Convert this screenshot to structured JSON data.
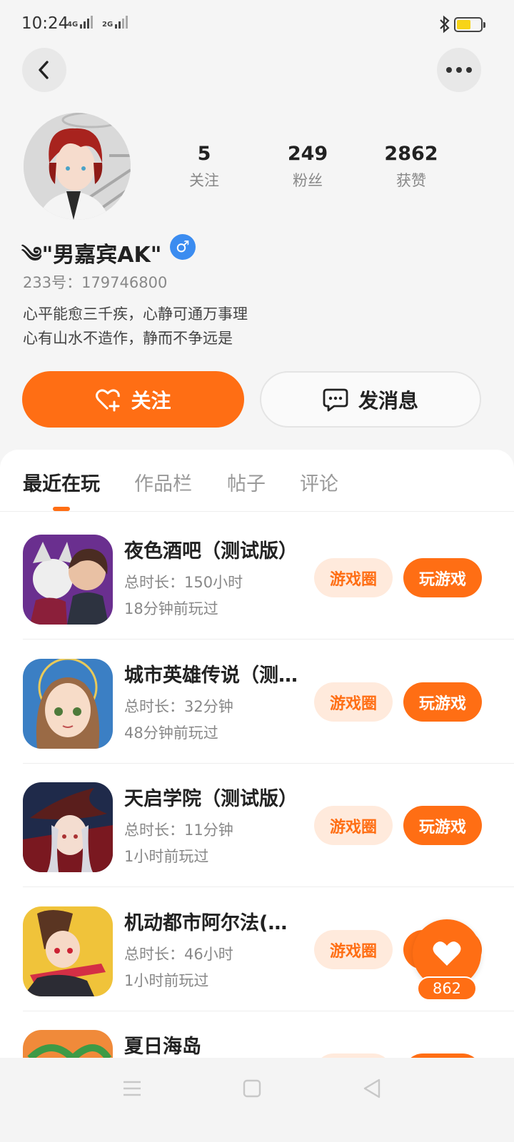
{
  "status_bar": {
    "time": "10:24",
    "net1": "4G",
    "net2": "2G",
    "icons": [
      "signal-icon",
      "bluetooth-icon",
      "battery-icon"
    ],
    "battery_color": "#f7d417"
  },
  "header": {
    "back_icon": "back-chevron-icon",
    "more_icon": "more-dots-icon"
  },
  "profile": {
    "username": "༄\"男嘉宾AK\"",
    "gender_symbol": "♂",
    "uid": "233号：179746800",
    "bio_line1": "心平能愈三千疾，心静可通万事理",
    "bio_line2": "心有山水不造作，静而不争远是",
    "stats": [
      {
        "value": "5",
        "label": "关注"
      },
      {
        "value": "249",
        "label": "粉丝"
      },
      {
        "value": "2862",
        "label": "获赞"
      }
    ]
  },
  "actions": {
    "follow_label": "关注",
    "message_label": "发消息"
  },
  "tabs": [
    {
      "label": "最近在玩",
      "active": true
    },
    {
      "label": "作品栏",
      "active": false
    },
    {
      "label": "帖子",
      "active": false
    },
    {
      "label": "评论",
      "active": false
    }
  ],
  "games": [
    {
      "title": "夜色酒吧（测试版）",
      "duration": "总时长：150小时",
      "last_played": "18分钟前玩过",
      "circle_label": "游戏圈",
      "play_label": "玩游戏"
    },
    {
      "title": "城市英雄传说（测...",
      "duration": "总时长：32分钟",
      "last_played": "48分钟前玩过",
      "circle_label": "游戏圈",
      "play_label": "玩游戏"
    },
    {
      "title": "天启学院（测试版）",
      "duration": "总时长：11分钟",
      "last_played": "1小时前玩过",
      "circle_label": "游戏圈",
      "play_label": "玩游戏"
    },
    {
      "title": "机动都市阿尔法(S...",
      "duration": "总时长：46小时",
      "last_played": "1小时前玩过",
      "circle_label": "游戏圈",
      "play_label": "玩游戏"
    },
    {
      "title": "夏日海岛",
      "duration": "",
      "last_played": "",
      "circle_label": "",
      "play_label": ""
    }
  ],
  "like_fab": {
    "count": "862",
    "icon": "heart-icon"
  },
  "nav": {
    "icons": [
      "menu-icon",
      "home-square-icon",
      "back-triangle-icon"
    ]
  },
  "colors": {
    "accent": "#ff6e14",
    "accent_light": "#ffeadc",
    "gender_blue": "#3b8cf0"
  }
}
